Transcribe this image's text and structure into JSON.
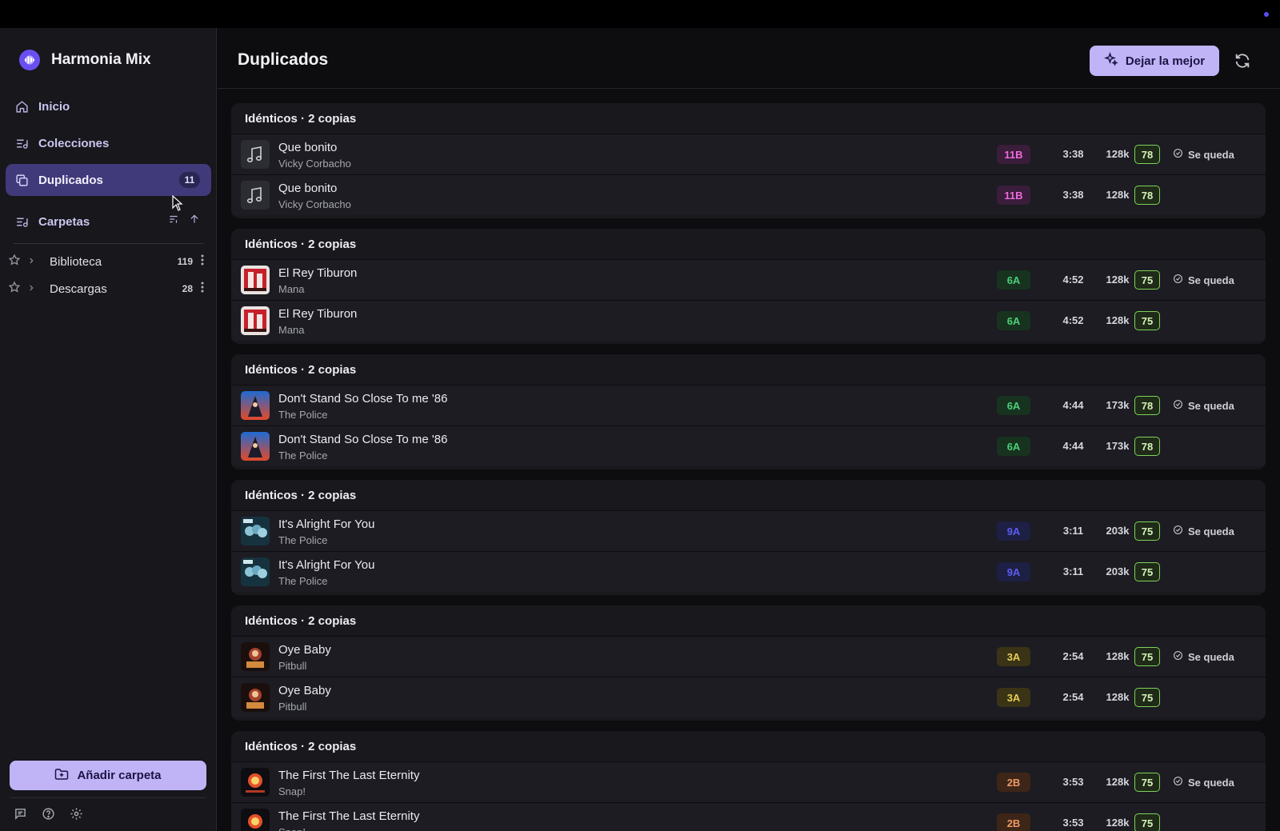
{
  "app": {
    "title": "Harmonia Mix"
  },
  "nav": {
    "items": [
      {
        "label": "Inicio",
        "icon": "home-icon"
      },
      {
        "label": "Colecciones",
        "icon": "collections-icon"
      },
      {
        "label": "Duplicados",
        "icon": "duplicates-icon",
        "count": "11",
        "active": true
      },
      {
        "label": "Carpetas",
        "icon": "folders-icon"
      }
    ]
  },
  "folders": [
    {
      "name": "Biblioteca",
      "count": "119"
    },
    {
      "name": "Descargas",
      "count": "28"
    }
  ],
  "sidebar_footer": {
    "add_folder_label": "Añadir carpeta"
  },
  "page": {
    "title": "Duplicados",
    "keep_best_label": "Dejar la mejor"
  },
  "groups": [
    {
      "title": "Idénticos · 2 copias",
      "tracks": [
        {
          "title": "Que bonito",
          "artist": "Vicky Corbacho",
          "key": "11B",
          "duration": "3:38",
          "bitrate": "128k",
          "score": "78",
          "keep": "Se queda"
        },
        {
          "title": "Que bonito",
          "artist": "Vicky Corbacho",
          "key": "11B",
          "duration": "3:38",
          "bitrate": "128k",
          "score": "78",
          "keep": ""
        }
      ]
    },
    {
      "title": "Idénticos · 2 copias",
      "tracks": [
        {
          "title": "El Rey Tiburon",
          "artist": "Mana",
          "key": "6A",
          "duration": "4:52",
          "bitrate": "128k",
          "score": "75",
          "keep": "Se queda"
        },
        {
          "title": "El Rey Tiburon",
          "artist": "Mana",
          "key": "6A",
          "duration": "4:52",
          "bitrate": "128k",
          "score": "75",
          "keep": ""
        }
      ]
    },
    {
      "title": "Idénticos · 2 copias",
      "tracks": [
        {
          "title": "Don't Stand So Close To me '86",
          "artist": "The Police",
          "key": "6A",
          "duration": "4:44",
          "bitrate": "173k",
          "score": "78",
          "keep": "Se queda"
        },
        {
          "title": "Don't Stand So Close To me '86",
          "artist": "The Police",
          "key": "6A",
          "duration": "4:44",
          "bitrate": "173k",
          "score": "78",
          "keep": ""
        }
      ]
    },
    {
      "title": "Idénticos · 2 copias",
      "tracks": [
        {
          "title": "It's Alright For You",
          "artist": "The Police",
          "key": "9A",
          "duration": "3:11",
          "bitrate": "203k",
          "score": "75",
          "keep": "Se queda"
        },
        {
          "title": "It's Alright For You",
          "artist": "The Police",
          "key": "9A",
          "duration": "3:11",
          "bitrate": "203k",
          "score": "75",
          "keep": ""
        }
      ]
    },
    {
      "title": "Idénticos · 2 copias",
      "tracks": [
        {
          "title": "Oye Baby",
          "artist": "Pitbull",
          "key": "3A",
          "duration": "2:54",
          "bitrate": "128k",
          "score": "75",
          "keep": "Se queda"
        },
        {
          "title": "Oye Baby",
          "artist": "Pitbull",
          "key": "3A",
          "duration": "2:54",
          "bitrate": "128k",
          "score": "75",
          "keep": ""
        }
      ]
    },
    {
      "title": "Idénticos · 2 copias",
      "tracks": [
        {
          "title": "The First The Last Eternity",
          "artist": "Snap!",
          "key": "2B",
          "duration": "3:53",
          "bitrate": "128k",
          "score": "75",
          "keep": "Se queda"
        },
        {
          "title": "The First The Last Eternity",
          "artist": "Snap!",
          "key": "2B",
          "duration": "3:53",
          "bitrate": "128k",
          "score": "75",
          "keep": ""
        }
      ]
    }
  ],
  "colors": {
    "accent": "#c0b4f7",
    "key_11B": "#e05fd0",
    "key_6A": "#3fbf6a",
    "key_9A": "#4b4fe0",
    "key_3A": "#d8c24a",
    "key_2B": "#e08a5a"
  }
}
